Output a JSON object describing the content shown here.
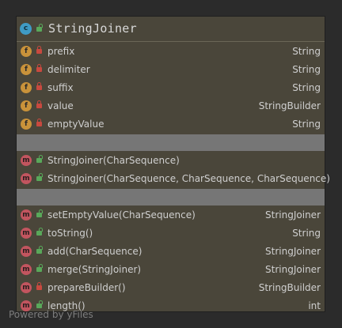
{
  "class_box": {
    "title": "StringJoiner",
    "header_icon": "class-icon",
    "fields": [
      {
        "badge": "f",
        "visibility": "private",
        "name": "prefix",
        "type": "String"
      },
      {
        "badge": "f",
        "visibility": "private",
        "name": "delimiter",
        "type": "String"
      },
      {
        "badge": "f",
        "visibility": "private",
        "name": "suffix",
        "type": "String"
      },
      {
        "badge": "f",
        "visibility": "private",
        "name": "value",
        "type": "StringBuilder"
      },
      {
        "badge": "f",
        "visibility": "private",
        "name": "emptyValue",
        "type": "String"
      }
    ],
    "constructors": [
      {
        "badge": "m",
        "visibility": "public",
        "name": "StringJoiner(CharSequence)",
        "type": ""
      },
      {
        "badge": "m",
        "visibility": "public",
        "name": "StringJoiner(CharSequence, CharSequence, CharSequence)",
        "type": ""
      }
    ],
    "methods": [
      {
        "badge": "m",
        "visibility": "public",
        "name": "setEmptyValue(CharSequence)",
        "type": "StringJoiner"
      },
      {
        "badge": "m",
        "visibility": "public",
        "name": "toString()",
        "type": "String"
      },
      {
        "badge": "m",
        "visibility": "public",
        "name": "add(CharSequence)",
        "type": "StringJoiner"
      },
      {
        "badge": "m",
        "visibility": "public",
        "name": "merge(StringJoiner)",
        "type": "StringJoiner"
      },
      {
        "badge": "m",
        "visibility": "private",
        "name": "prepareBuilder()",
        "type": "StringBuilder"
      },
      {
        "badge": "m",
        "visibility": "public",
        "name": "length()",
        "type": "int"
      }
    ]
  },
  "colors": {
    "background": "#2b2b2b",
    "box_fill": "#4a463a",
    "separator": "#767676",
    "field_badge": "#c9923a",
    "method_badge": "#c2555f",
    "class_badge": "#3f9bc5",
    "private_lock": "#c8493f",
    "public_lock": "#59a85a"
  },
  "watermark": "Powered by yFiles"
}
